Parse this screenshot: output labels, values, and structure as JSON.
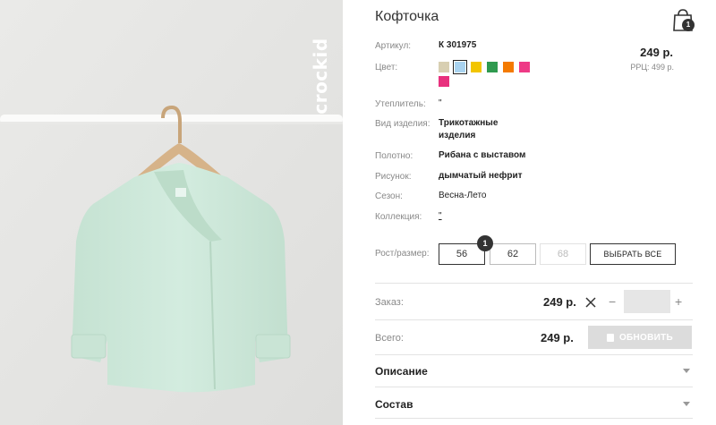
{
  "product": {
    "title": "Кофточка",
    "brand_logo_text": "crockid",
    "cart_count": "1"
  },
  "details": {
    "article_label": "Артикул:",
    "article_value": "К 301975",
    "color_label": "Цвет:",
    "insulation_label": "Утеплитель:",
    "insulation_value": "\"",
    "type_label": "Вид изделия:",
    "type_value_line1": "Трикотажные",
    "type_value_line2": "изделия",
    "fabric_label": "Полотно:",
    "fabric_value": "Рибана с выставом",
    "pattern_label": "Рисунок:",
    "pattern_value": "дымчатый нефрит",
    "season_label": "Сезон:",
    "season_value": "Весна-Лето",
    "collection_label": "Коллекция:",
    "collection_value": "\""
  },
  "pricing": {
    "price": "249 р.",
    "rrp": "РРЦ: 499 р."
  },
  "colors": [
    {
      "hex": "#d8cfb2",
      "selected": false
    },
    {
      "hex": "#a9d3f0",
      "selected": true
    },
    {
      "hex": "#f2c500",
      "selected": false
    },
    {
      "hex": "#2f9a4f",
      "selected": false
    },
    {
      "hex": "#f47a00",
      "selected": false
    },
    {
      "hex": "#ee3a86",
      "selected": false
    },
    {
      "hex": "#e8317e",
      "selected": false
    }
  ],
  "sizes": {
    "label": "Рост/размер:",
    "options": [
      {
        "value": "56",
        "state": "active"
      },
      {
        "value": "62",
        "state": "normal"
      },
      {
        "value": "68",
        "state": "disabled"
      }
    ],
    "badge": "1",
    "select_all_label": "ВЫБРАТЬ ВСЕ"
  },
  "order": {
    "label": "Заказ:",
    "price": "249 р.",
    "minus": "−",
    "plus": "+",
    "quantity": ""
  },
  "total": {
    "label": "Всего:",
    "price": "249 р.",
    "update_label": "ОБНОВИТЬ"
  },
  "accordion": {
    "description_label": "Описание",
    "composition_label": "Состав"
  },
  "icons": {
    "cart": "shopping-bag-icon",
    "remove": "close-icon",
    "update": "basket-icon",
    "expand": "chevron-down-icon"
  }
}
